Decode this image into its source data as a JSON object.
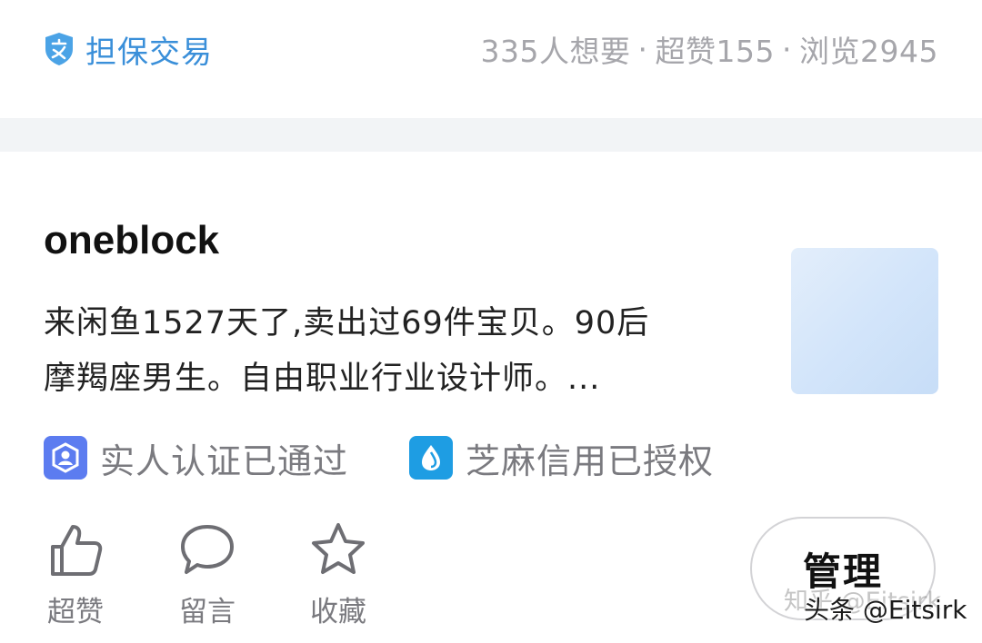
{
  "header": {
    "guarantee_label": "担保交易",
    "want_count": "335人想要",
    "likes": "超赞155",
    "views": "浏览2945",
    "separator": "·"
  },
  "seller": {
    "name": "oneblock",
    "bio_line1": "来闲鱼1527天了,卖出过69件宝贝。90后",
    "bio_line2": "摩羯座男生。自由职业行业设计师。..."
  },
  "certifications": [
    {
      "label": "实人认证已通过",
      "icon": "user-verified-icon",
      "color": "#5c7cf0"
    },
    {
      "label": "芝麻信用已授权",
      "icon": "sesame-credit-icon",
      "color": "#1e9de3"
    }
  ],
  "actions": [
    {
      "label": "超赞",
      "icon": "thumbs-up-icon"
    },
    {
      "label": "留言",
      "icon": "comment-bubble-icon"
    },
    {
      "label": "收藏",
      "icon": "star-icon"
    }
  ],
  "manage_button": "管理",
  "watermark": {
    "faded": "知乎 @Eitsirk",
    "main": "头条 @Eitsirk"
  },
  "colors": {
    "accent_blue": "#3a8fd9",
    "muted_text": "#a6a6ab",
    "divider": "#f2f4f6"
  }
}
